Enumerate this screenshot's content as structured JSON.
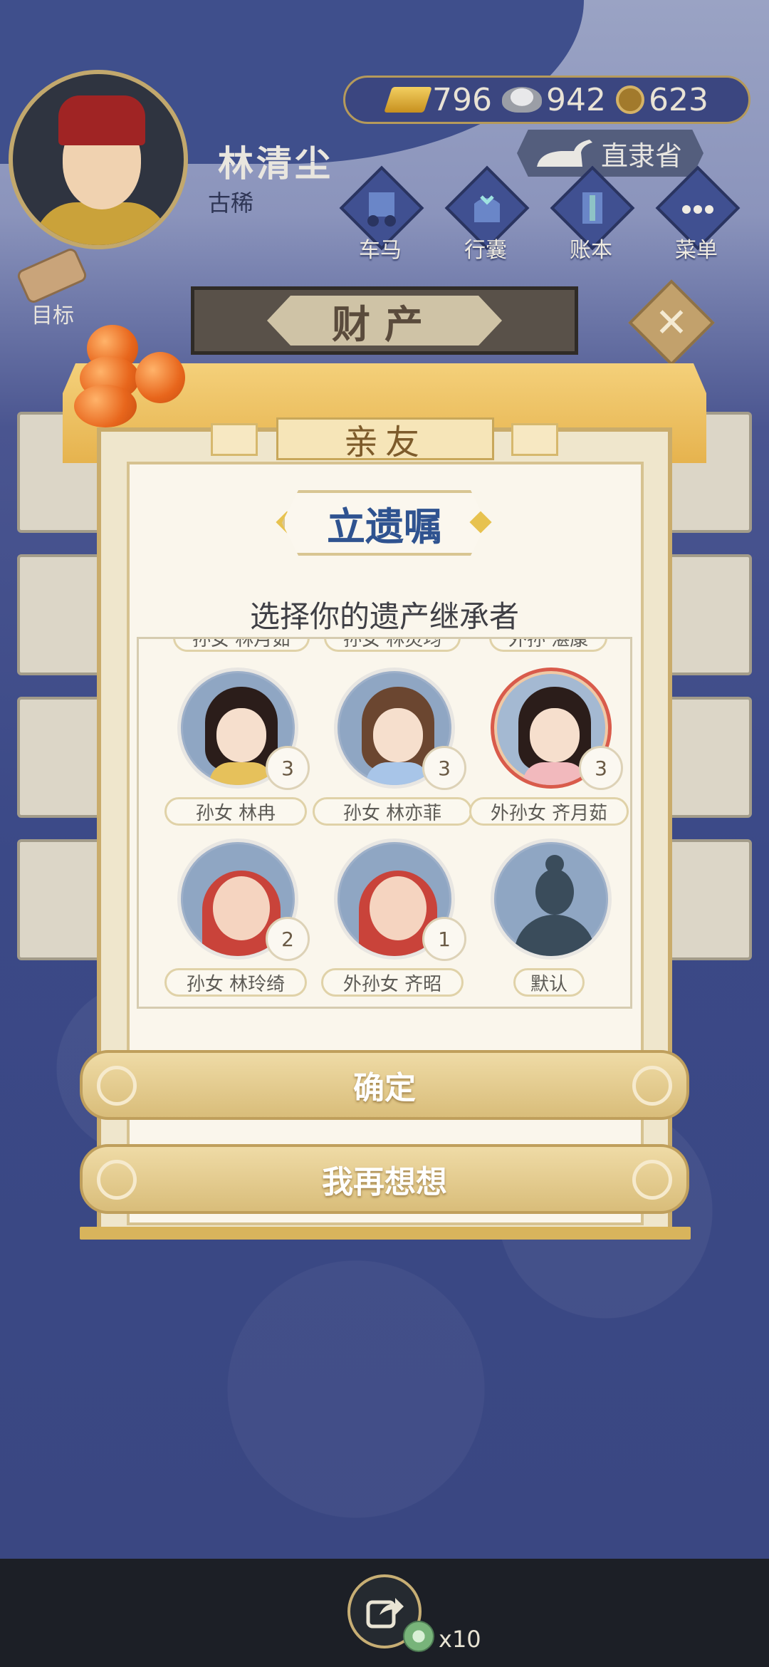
{
  "player": {
    "name": "林清尘",
    "age_stage": "古稀"
  },
  "currency": {
    "gold": "796",
    "silver": "942",
    "copper": "623"
  },
  "location": "直隶省",
  "nav": [
    {
      "label": "车马",
      "icon": "carriage-icon"
    },
    {
      "label": "行囊",
      "icon": "bundle-icon"
    },
    {
      "label": "账本",
      "icon": "ledger-icon"
    },
    {
      "label": "菜单",
      "icon": "menu-dots-icon"
    }
  ],
  "goal_label": "目标",
  "page_title": "财产",
  "modal": {
    "tab_label": "亲友",
    "title": "立遗嘱",
    "subtitle": "选择你的遗产继承者",
    "cut_row": [
      "孙女 林月茹",
      "孙女 林灵均",
      "外孙 湛康"
    ],
    "heirs": [
      {
        "name": "孙女 林冉",
        "count": "3"
      },
      {
        "name": "孙女 林亦菲",
        "count": "3"
      },
      {
        "name": "外孙女 齐月茹",
        "count": "3"
      },
      {
        "name": "孙女 林玲绮",
        "count": "2"
      },
      {
        "name": "外孙女 齐昭",
        "count": "1"
      },
      {
        "name": "默认",
        "count": ""
      }
    ],
    "confirm_label": "确定",
    "cancel_label": "我再想想"
  },
  "share": {
    "count": "x10"
  },
  "colors": {
    "background": "#3c4a80",
    "accent_gold": "#d9bd7a",
    "title_blue": "#2f5390"
  }
}
